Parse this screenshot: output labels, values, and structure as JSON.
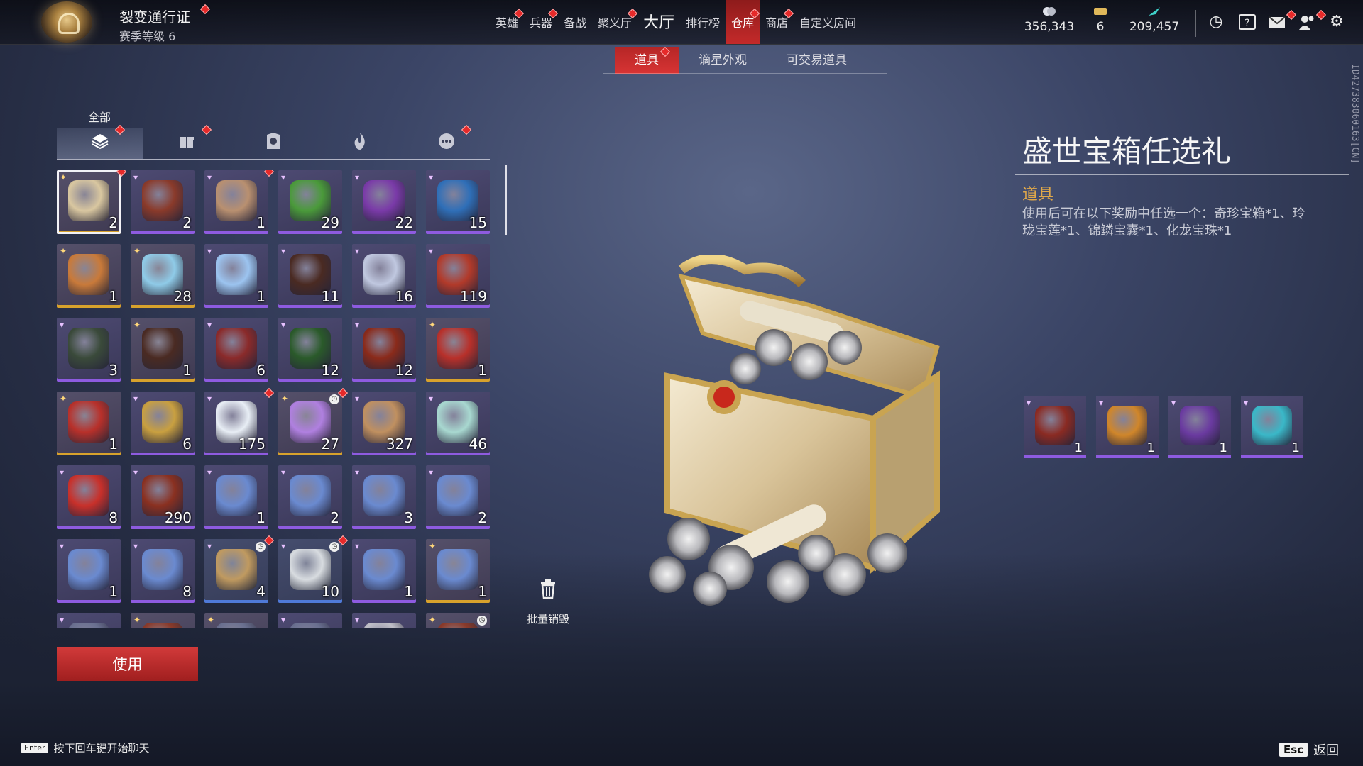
{
  "pass": {
    "title": "裂变通行证",
    "level": "赛季等级 6"
  },
  "nav": [
    {
      "label": "英雄",
      "dot": true,
      "big": false,
      "active": false
    },
    {
      "label": "兵器",
      "dot": true,
      "big": false,
      "active": false
    },
    {
      "label": "备战",
      "dot": false,
      "big": false,
      "active": false
    },
    {
      "label": "聚义厅",
      "dot": true,
      "big": false,
      "active": false
    },
    {
      "label": "大厅",
      "dot": false,
      "big": true,
      "active": false
    },
    {
      "label": "排行榜",
      "dot": false,
      "big": false,
      "active": false
    },
    {
      "label": "仓库",
      "dot": true,
      "big": false,
      "active": true
    },
    {
      "label": "商店",
      "dot": true,
      "big": false,
      "active": false
    },
    {
      "label": "自定义房间",
      "dot": false,
      "big": false,
      "active": false
    }
  ],
  "currency": {
    "coins": "356,343",
    "tickets": "6",
    "gold": "209,457"
  },
  "subtabs": [
    {
      "label": "道具",
      "active": true,
      "dot": true
    },
    {
      "label": "谪星外观",
      "active": false,
      "dot": false
    },
    {
      "label": "可交易道具",
      "active": false,
      "dot": false
    }
  ],
  "category": {
    "label": "全部",
    "tabs": [
      {
        "name": "all",
        "icon": "layers-icon",
        "active": true,
        "dot": true
      },
      {
        "name": "gift",
        "icon": "gift-icon",
        "active": false,
        "dot": true
      },
      {
        "name": "badge",
        "icon": "badge-icon",
        "active": false,
        "dot": false
      },
      {
        "name": "flame",
        "icon": "flame-icon",
        "active": false,
        "dot": false
      },
      {
        "name": "more",
        "icon": "more-icon",
        "active": false,
        "dot": true
      }
    ]
  },
  "items": [
    {
      "count": "2",
      "rarity": "legend",
      "color": "#d9c7a0",
      "selected": true,
      "dot": true
    },
    {
      "count": "2",
      "rarity": "epic",
      "color": "#8a3a2a"
    },
    {
      "count": "1",
      "rarity": "epic",
      "color": "#b99070",
      "dot": true
    },
    {
      "count": "29",
      "rarity": "epic",
      "color": "#4a9a3a"
    },
    {
      "count": "22",
      "rarity": "epic",
      "color": "#7a3aa8"
    },
    {
      "count": "15",
      "rarity": "epic",
      "color": "#2f6fb8"
    },
    {
      "count": "1",
      "rarity": "legend",
      "color": "#c97a3a"
    },
    {
      "count": "28",
      "rarity": "legend",
      "color": "#8fcbe8"
    },
    {
      "count": "1",
      "rarity": "epic",
      "color": "#9cc4f0"
    },
    {
      "count": "11",
      "rarity": "epic",
      "color": "#4a2a22"
    },
    {
      "count": "16",
      "rarity": "epic",
      "color": "#c0c8e0"
    },
    {
      "count": "119",
      "rarity": "epic",
      "color": "#b23a2a"
    },
    {
      "count": "3",
      "rarity": "epic",
      "color": "#3a4a3a"
    },
    {
      "count": "1",
      "rarity": "legend",
      "color": "#4a2a22"
    },
    {
      "count": "6",
      "rarity": "epic",
      "color": "#8a2a2a"
    },
    {
      "count": "12",
      "rarity": "epic",
      "color": "#2a5a2a"
    },
    {
      "count": "12",
      "rarity": "epic",
      "color": "#8a2a1a"
    },
    {
      "count": "1",
      "rarity": "legend",
      "color": "#b8302a"
    },
    {
      "count": "1",
      "rarity": "legend",
      "color": "#b8302a"
    },
    {
      "count": "6",
      "rarity": "epic",
      "color": "#c9a040"
    },
    {
      "count": "175",
      "rarity": "epic",
      "color": "#e8eef5",
      "dot": true
    },
    {
      "count": "27",
      "rarity": "legend",
      "color": "#b080e0",
      "clock": true,
      "dot": true
    },
    {
      "count": "327",
      "rarity": "epic",
      "color": "#c09060"
    },
    {
      "count": "46",
      "rarity": "epic",
      "color": "#a8d8d0"
    },
    {
      "count": "8",
      "rarity": "epic",
      "color": "#c8302a"
    },
    {
      "count": "290",
      "rarity": "epic",
      "color": "#8a3020"
    },
    {
      "count": "1",
      "rarity": "epic",
      "color": "#6a8ad0"
    },
    {
      "count": "2",
      "rarity": "epic",
      "color": "#6a8ad0"
    },
    {
      "count": "3",
      "rarity": "epic",
      "color": "#6a8ad0"
    },
    {
      "count": "2",
      "rarity": "epic",
      "color": "#6a8ad0"
    },
    {
      "count": "1",
      "rarity": "epic",
      "color": "#6a8ad0"
    },
    {
      "count": "8",
      "rarity": "epic",
      "color": "#6a8ad0"
    },
    {
      "count": "4",
      "rarity": "rare",
      "color": "#c09a60",
      "clock": true,
      "dot": true
    },
    {
      "count": "10",
      "rarity": "rare",
      "color": "#d8dce0",
      "clock": true,
      "dot": true
    },
    {
      "count": "1",
      "rarity": "epic",
      "color": "#6a8ad0"
    },
    {
      "count": "1",
      "rarity": "legend",
      "color": "#6a8ad0"
    },
    {
      "count": "",
      "rarity": "epic",
      "color": "#6a7090"
    },
    {
      "count": "",
      "rarity": "legend",
      "color": "#8a3a2a"
    },
    {
      "count": "",
      "rarity": "legend",
      "color": "#6a7090"
    },
    {
      "count": "",
      "rarity": "epic",
      "color": "#6a7090"
    },
    {
      "count": "",
      "rarity": "epic",
      "color": "#c0c0c8"
    },
    {
      "count": "",
      "rarity": "legend",
      "color": "#8a3a2a",
      "clock": true
    }
  ],
  "use_label": "使用",
  "batch_destroy_label": "批量销毁",
  "detail": {
    "title": "盛世宝箱任选礼",
    "type": "道具",
    "description": "使用后可在以下奖励中任选一个：奇珍宝箱*1、玲珑宝莲*1、锦鳞宝囊*1、化龙宝珠*1"
  },
  "rewards": [
    {
      "count": "1",
      "color": "#8a2a22"
    },
    {
      "count": "1",
      "color": "#d0862a"
    },
    {
      "count": "1",
      "color": "#6a3aa0"
    },
    {
      "count": "1",
      "color": "#3ab8c8"
    }
  ],
  "uid": "ID427383060163[CN]",
  "footer": {
    "enter_key": "Enter",
    "chat_hint": "按下回车键开始聊天",
    "esc_key": "Esc",
    "back_label": "返回"
  }
}
